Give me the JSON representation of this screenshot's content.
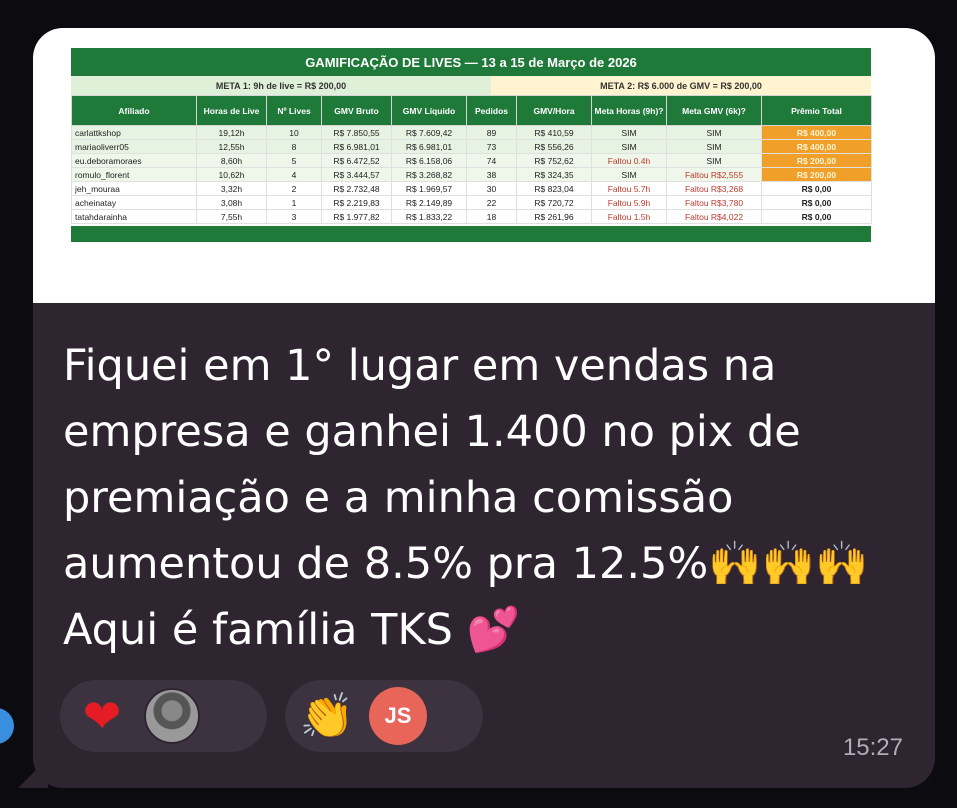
{
  "sheet": {
    "title": "GAMIFICAÇÃO DE LIVES — 13 a 15 de Março de 2026",
    "meta1": "META 1: 9h de live = R$ 200,00",
    "meta2": "META 2: R$ 6.000 de GMV = R$ 200,00",
    "headers": [
      "Afiliado",
      "Horas de Live",
      "Nº Lives",
      "GMV Bruto",
      "GMV Líquido",
      "Pedidos",
      "GMV/Hora",
      "Meta Horas (9h)?",
      "Meta GMV (6k)?",
      "Prêmio Total"
    ],
    "rows": [
      [
        "carlattkshop",
        "19,12h",
        "10",
        "R$ 7.850,55",
        "R$ 7.609,42",
        "89",
        "R$ 410,59",
        "SIM",
        "SIM",
        "R$ 400,00"
      ],
      [
        "mariaoliverr05",
        "12,55h",
        "8",
        "R$ 6.981,01",
        "R$ 6.981,01",
        "73",
        "R$ 556,26",
        "SIM",
        "SIM",
        "R$ 400,00"
      ],
      [
        "eu.deboramoraes",
        "8,60h",
        "5",
        "R$ 6.472,52",
        "R$ 6.158,06",
        "74",
        "R$ 752,62",
        "Faltou 0.4h",
        "SIM",
        "R$ 200,00"
      ],
      [
        "romulo_florent",
        "10,62h",
        "4",
        "R$ 3.444,57",
        "R$ 3.268,82",
        "38",
        "R$ 324,35",
        "SIM",
        "Faltou R$2,555",
        "R$ 200,00"
      ],
      [
        "jeh_mouraa",
        "3,32h",
        "2",
        "R$ 2.732,48",
        "R$ 1.969,57",
        "30",
        "R$ 823,04",
        "Faltou 5.7h",
        "Faltou R$3,268",
        "R$ 0,00"
      ],
      [
        "acheinatay",
        "3,08h",
        "1",
        "R$ 2.219,83",
        "R$ 2.149,89",
        "22",
        "R$ 720,72",
        "Faltou 5.9h",
        "Faltou R$3,780",
        "R$ 0,00"
      ],
      [
        "tatahdarainha",
        "7,55h",
        "3",
        "R$ 1.977,82",
        "R$ 1.833,22",
        "18",
        "R$ 261,96",
        "Faltou 1.5h",
        "Faltou R$4,022",
        "R$ 0,00"
      ]
    ]
  },
  "message": {
    "line1": "Fiquei em 1° lugar em vendas na",
    "line2": "empresa e ganhei 1.400 no pix de",
    "line3": "premiação e a minha comissão",
    "line4": "aumentou de 8.5% pra 12.5%",
    "line4_emoji": "🙌🙌🙌",
    "line5": "Aqui é família TKS",
    "line5_emoji": "💕",
    "time": "15:27"
  },
  "reactions": [
    {
      "emoji": "❤",
      "icon": "heart-icon"
    },
    {
      "emoji": "👏",
      "icon": "clapping-hands-icon",
      "avatar_initials": "JS"
    }
  ],
  "colors": {
    "bubble": "#2e2531",
    "sheet_green": "#1f7a3a",
    "prize_gold": "#f0a028",
    "fail_red": "#c0392b",
    "avatar_js": "#e8655a"
  }
}
